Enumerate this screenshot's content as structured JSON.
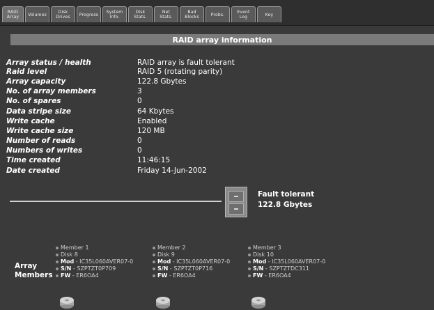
{
  "tabs": [
    {
      "label": "RAID\nArray",
      "active": true
    },
    {
      "label": "Volumes"
    },
    {
      "label": "Disk\nDrives"
    },
    {
      "label": "Progress"
    },
    {
      "label": "System\nInfo."
    },
    {
      "label": "Disk\nStats."
    },
    {
      "label": "Net\nStats."
    },
    {
      "label": "Bad\nBlocks"
    },
    {
      "label": "Probs."
    },
    {
      "label": "Event\nLog"
    },
    {
      "label": "Key"
    }
  ],
  "section_title": "RAID array information",
  "info": [
    {
      "label": "Array status / health",
      "value": "RAID array is fault tolerant"
    },
    {
      "label": "Raid level",
      "value": "RAID 5 (rotating parity)"
    },
    {
      "label": "Array capacity",
      "value": "122.8 Gbytes"
    },
    {
      "label": "No. of array members",
      "value": "3"
    },
    {
      "label": "No. of spares",
      "value": "0"
    },
    {
      "label": "Data stripe size",
      "value": "64 Kbytes"
    },
    {
      "label": "Write cache",
      "value": "Enabled"
    },
    {
      "label": "Write cache size",
      "value": "120 MB"
    },
    {
      "label": "Number of reads",
      "value": "0"
    },
    {
      "label": "Numbers of writes",
      "value": "0"
    },
    {
      "label": "Time created",
      "value": "11:46:15"
    },
    {
      "label": "Date created",
      "value": "Friday 14-Jun-2002"
    }
  ],
  "array_graphic": {
    "status": "Fault tolerant",
    "capacity": "122.8 Gbytes",
    "icon": "filing-cabinet-icon"
  },
  "array_members": {
    "label_line1": "Array",
    "label_line2": "Members",
    "mod_label": "Mod",
    "sn_label": "S/N",
    "fw_label": "FW",
    "members": [
      {
        "member": "Member 1",
        "disk": "Disk 8",
        "mod": " - IC35L060AVER07-0",
        "sn": " - SZPTZT0P709",
        "fw": " - ER6OA4"
      },
      {
        "member": "Member 2",
        "disk": "Disk 9",
        "mod": " - IC35L060AVER07-0",
        "sn": " - SZPTZT0P716",
        "fw": " - ER6OA4"
      },
      {
        "member": "Member 3",
        "disk": "Disk 10",
        "mod": " - IC35L060AVER07-0",
        "sn": " - SZPTZTDC311",
        "fw": " - ER6OA4"
      }
    ]
  },
  "colors": {
    "background": "#3a3a3a",
    "title_band": "#7a7a7a",
    "text": "#ffffff"
  }
}
